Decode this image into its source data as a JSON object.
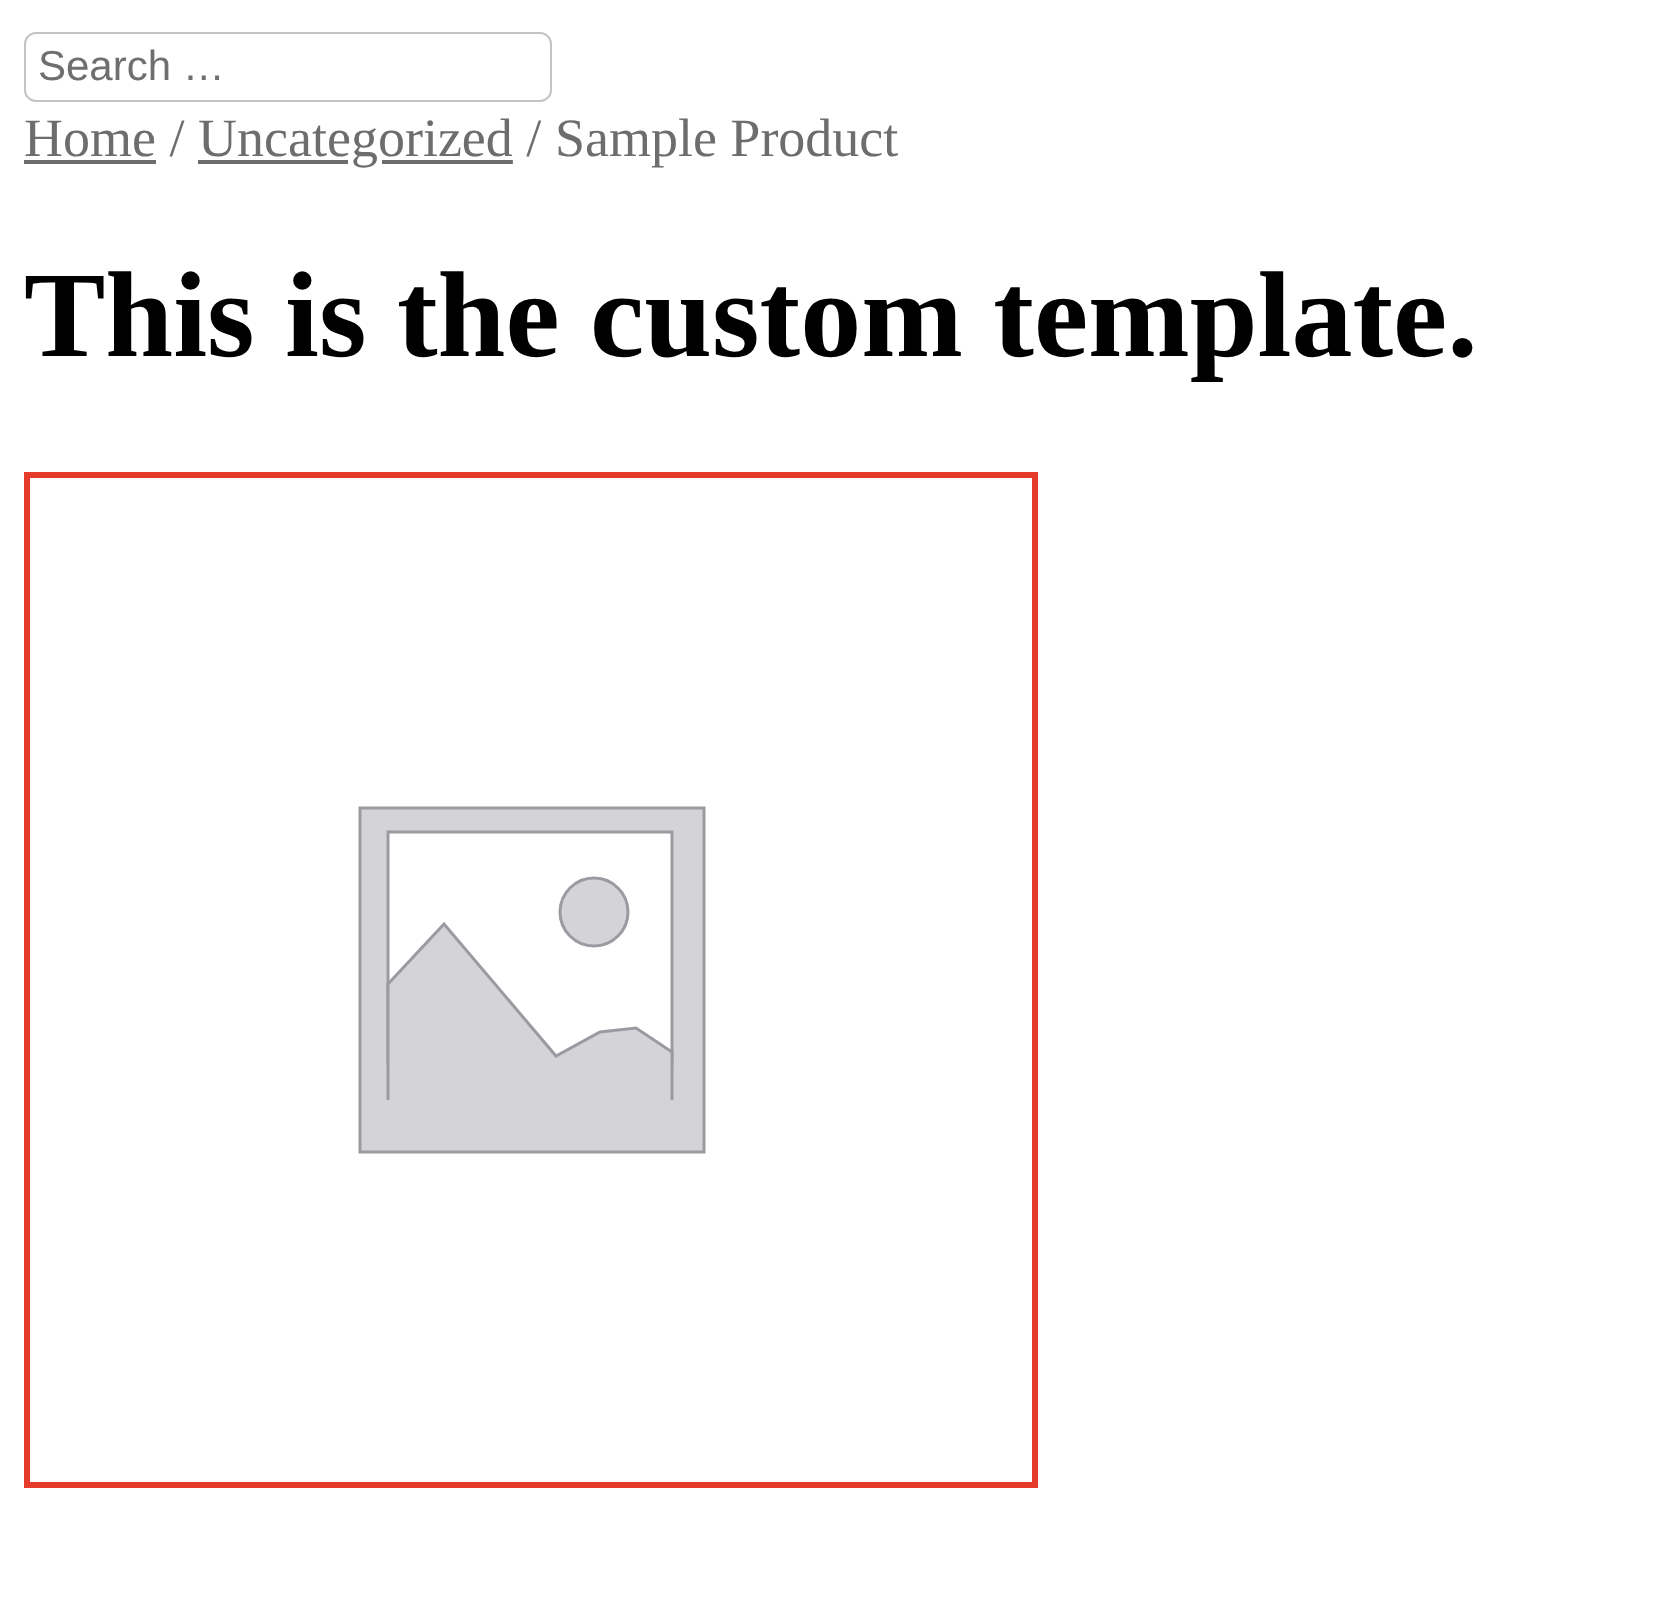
{
  "search": {
    "placeholder": "Search …"
  },
  "breadcrumb": {
    "links": [
      "Home",
      "Uncategorized"
    ],
    "separator": "/",
    "current": "Sample Product"
  },
  "heading": "This is the custom template.",
  "product_image": {
    "kind": "placeholder"
  }
}
